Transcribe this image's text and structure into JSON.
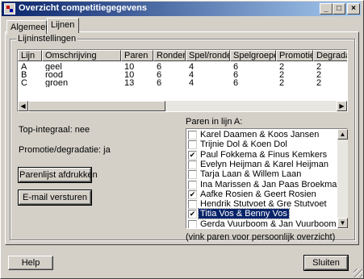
{
  "window": {
    "title": "Overzicht competitiegegevens"
  },
  "titlebar": {
    "minimize": "_",
    "maximize": "□",
    "close": "×"
  },
  "tabs": [
    {
      "label": "Algemeen"
    },
    {
      "label": "Lijnen"
    }
  ],
  "group": {
    "label": "Lijninstellingen"
  },
  "table": {
    "headers": [
      "Lijn",
      "Omschrijving",
      "Paren",
      "Ronden",
      "Spel/ronde",
      "Spelgroepen",
      "Promotie",
      "Degradatie"
    ],
    "rows": [
      [
        "A",
        "geel",
        "10",
        "6",
        "4",
        "6",
        "2",
        "2"
      ],
      [
        "B",
        "rood",
        "10",
        "6",
        "4",
        "6",
        "2",
        "2"
      ],
      [
        "C",
        "groen",
        "13",
        "6",
        "4",
        "6",
        "2",
        "2"
      ]
    ]
  },
  "info": {
    "top_integraal": "Top-integraal: nee",
    "promotie_degradatie": "Promotie/degradatie: ja"
  },
  "buttons": {
    "print": "Parenlijst afdrukken",
    "email": "E-mail versturen",
    "help": "Help",
    "close": "Sluiten"
  },
  "pairs": {
    "label": "Paren in lijn A:",
    "items": [
      {
        "name": "Karel Daamen & Koos Jansen",
        "checked": false
      },
      {
        "name": "Trijnie Dol & Koen Dol",
        "checked": false
      },
      {
        "name": "Paul Fokkema & Finus Kemkers",
        "checked": true
      },
      {
        "name": "Evelyn Heijman & Karel Heijman",
        "checked": false
      },
      {
        "name": "Tarja Laan & Willem Laan",
        "checked": false
      },
      {
        "name": "Ina Marissen & Jan Paas Broekman",
        "checked": false
      },
      {
        "name": "Aafke Rosien & Geert Rosien",
        "checked": true
      },
      {
        "name": "Hendrik Stutvoet & Gre Stutvoet",
        "checked": false
      },
      {
        "name": "Titia Vos & Benny Vos",
        "checked": true,
        "selected": true
      },
      {
        "name": "Gerda Vuurboom & Jan Vuurboom",
        "checked": false
      }
    ],
    "hint": "(vink paren voor persoonlijk overzicht)"
  }
}
